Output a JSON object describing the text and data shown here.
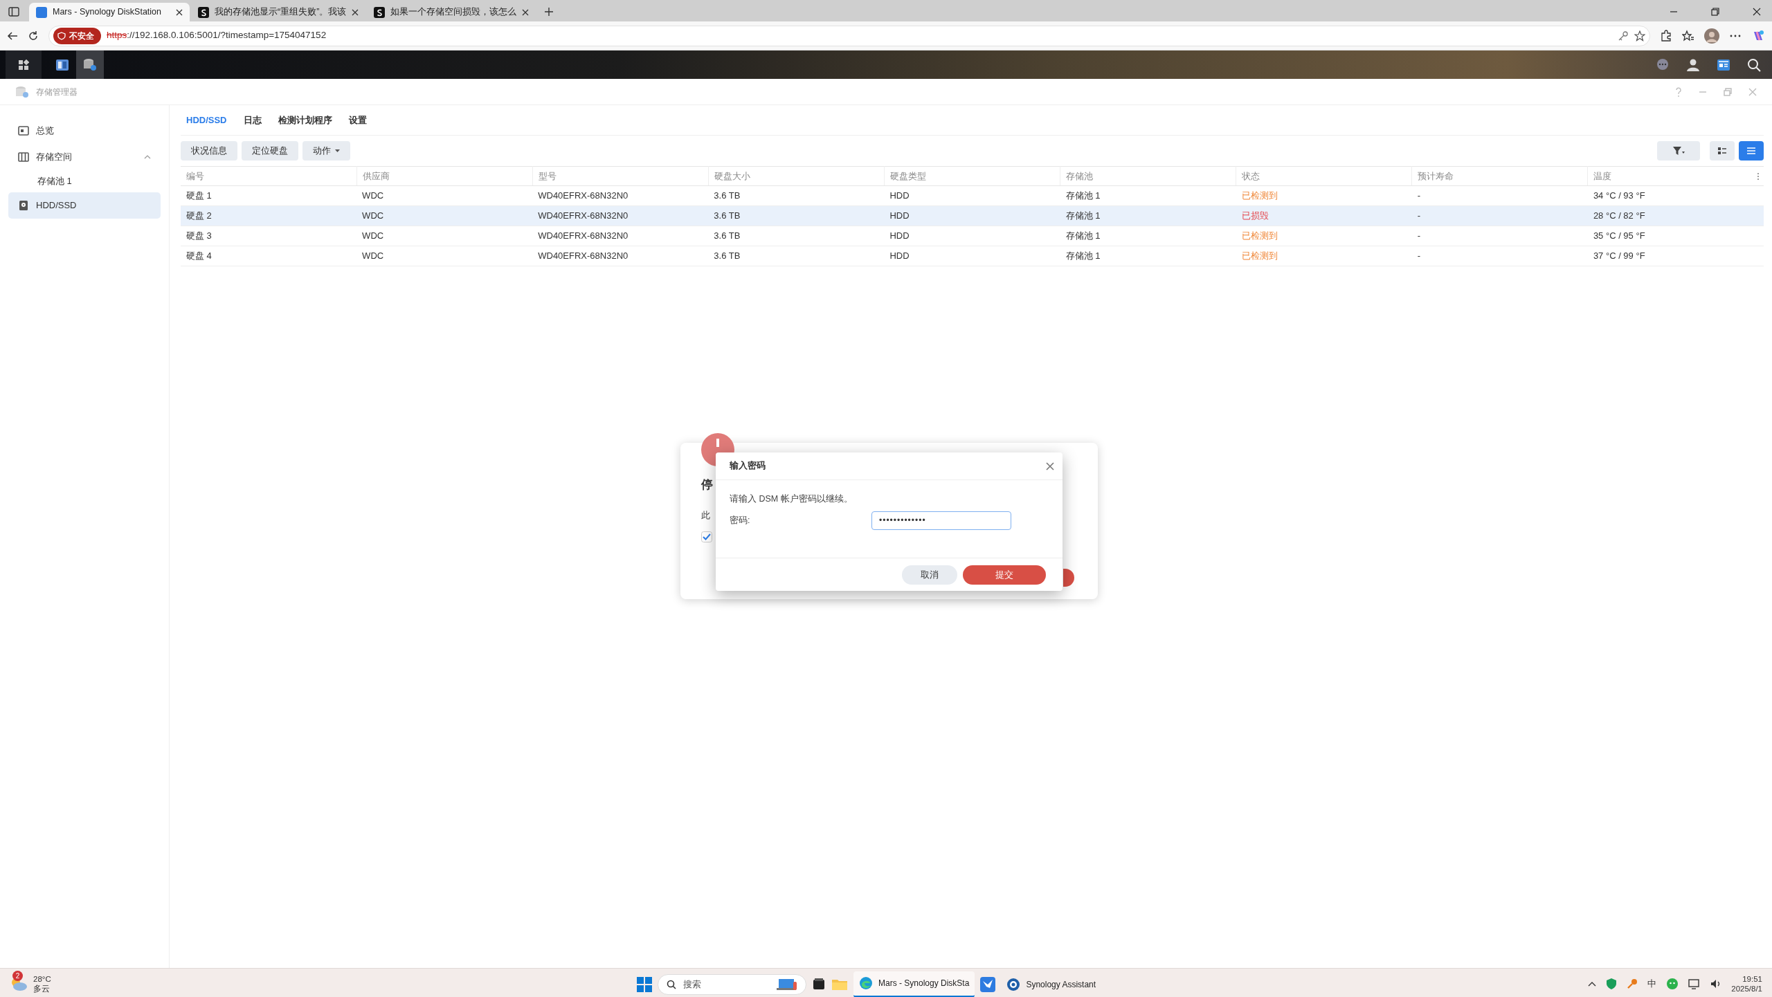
{
  "browser": {
    "tabs": [
      {
        "title": "Mars - Synology DiskStation",
        "selected": true
      },
      {
        "title": "我的存储池显示“重组失败”。我该",
        "selected": false
      },
      {
        "title": "如果一个存储空间损毁，该怎么",
        "selected": false
      }
    ],
    "security_label": "不安全",
    "scheme": "https",
    "address": "://192.168.0.106:5001/?timestamp=1754047152"
  },
  "app": {
    "title": "存储管理器",
    "sidebar": {
      "items": [
        {
          "label": "总览",
          "selected": false
        },
        {
          "label": "存储空间",
          "selected": false,
          "expanded": true,
          "children": [
            {
              "label": "存储池 1",
              "selected": false
            }
          ]
        },
        {
          "label": "HDD/SSD",
          "selected": true
        }
      ]
    },
    "tabs": [
      {
        "label": "HDD/SSD",
        "selected": true
      },
      {
        "label": "日志",
        "selected": false
      },
      {
        "label": "检测计划程序",
        "selected": false
      },
      {
        "label": "设置",
        "selected": false
      }
    ],
    "toolbar": [
      {
        "label": "状况信息",
        "dropdown": false
      },
      {
        "label": "定位硬盘",
        "dropdown": false
      },
      {
        "label": "动作",
        "dropdown": true
      }
    ],
    "views": [
      {
        "kind": "cards",
        "selected": false
      },
      {
        "kind": "list",
        "selected": true
      }
    ],
    "table": {
      "columns": [
        "编号",
        "供应商",
        "型号",
        "硬盘大小",
        "硬盘类型",
        "存储池",
        "状态",
        "预计寿命",
        "温度"
      ],
      "rows": [
        {
          "cells": [
            "硬盘 1",
            "WDC",
            "WD40EFRX-68N32N0",
            "3.6 TB",
            "HDD",
            "存储池 1",
            "已检测到",
            "-",
            "34 °C / 93 °F"
          ],
          "color": "#f0883a",
          "selected": false
        },
        {
          "cells": [
            "硬盘 2",
            "WDC",
            "WD40EFRX-68N32N0",
            "3.6 TB",
            "HDD",
            "存储池 1",
            "已损毁",
            "-",
            "28 °C / 82 °F"
          ],
          "color": "#e5484d",
          "selected": true
        },
        {
          "cells": [
            "硬盘 3",
            "WDC",
            "WD40EFRX-68N32N0",
            "3.6 TB",
            "HDD",
            "存储池 1",
            "已检测到",
            "-",
            "35 °C / 95 °F"
          ],
          "color": "#f0883a",
          "selected": false
        },
        {
          "cells": [
            "硬盘 4",
            "WDC",
            "WD40EFRX-68N32N0",
            "3.6 TB",
            "HDD",
            "存储池 1",
            "已检测到",
            "-",
            "37 °C / 99 °F"
          ],
          "color": "#f0883a",
          "selected": false
        }
      ]
    }
  },
  "back_dialog": {
    "title": "停",
    "text": "此",
    "checked": true
  },
  "dialog": {
    "title": "输入密码",
    "message": "请输入 DSM 帐户密码以继续。",
    "field_label": "密码:",
    "value": "•••••••••••••",
    "buttons": [
      {
        "label": "取消",
        "kind": "secondary"
      },
      {
        "label": "提交",
        "kind": "primary"
      }
    ]
  },
  "taskbar": {
    "weather": {
      "badge": "2",
      "temperature": "28°C",
      "condition": "多云"
    },
    "search": {
      "placeholder": "搜索"
    },
    "apps": [
      {
        "label": "Mars - Synology DiskSta",
        "selected": true
      },
      {
        "label": "Synology Assistant",
        "selected": false
      }
    ],
    "ime": "中",
    "time": "19:51",
    "date": "2025/8/1"
  }
}
